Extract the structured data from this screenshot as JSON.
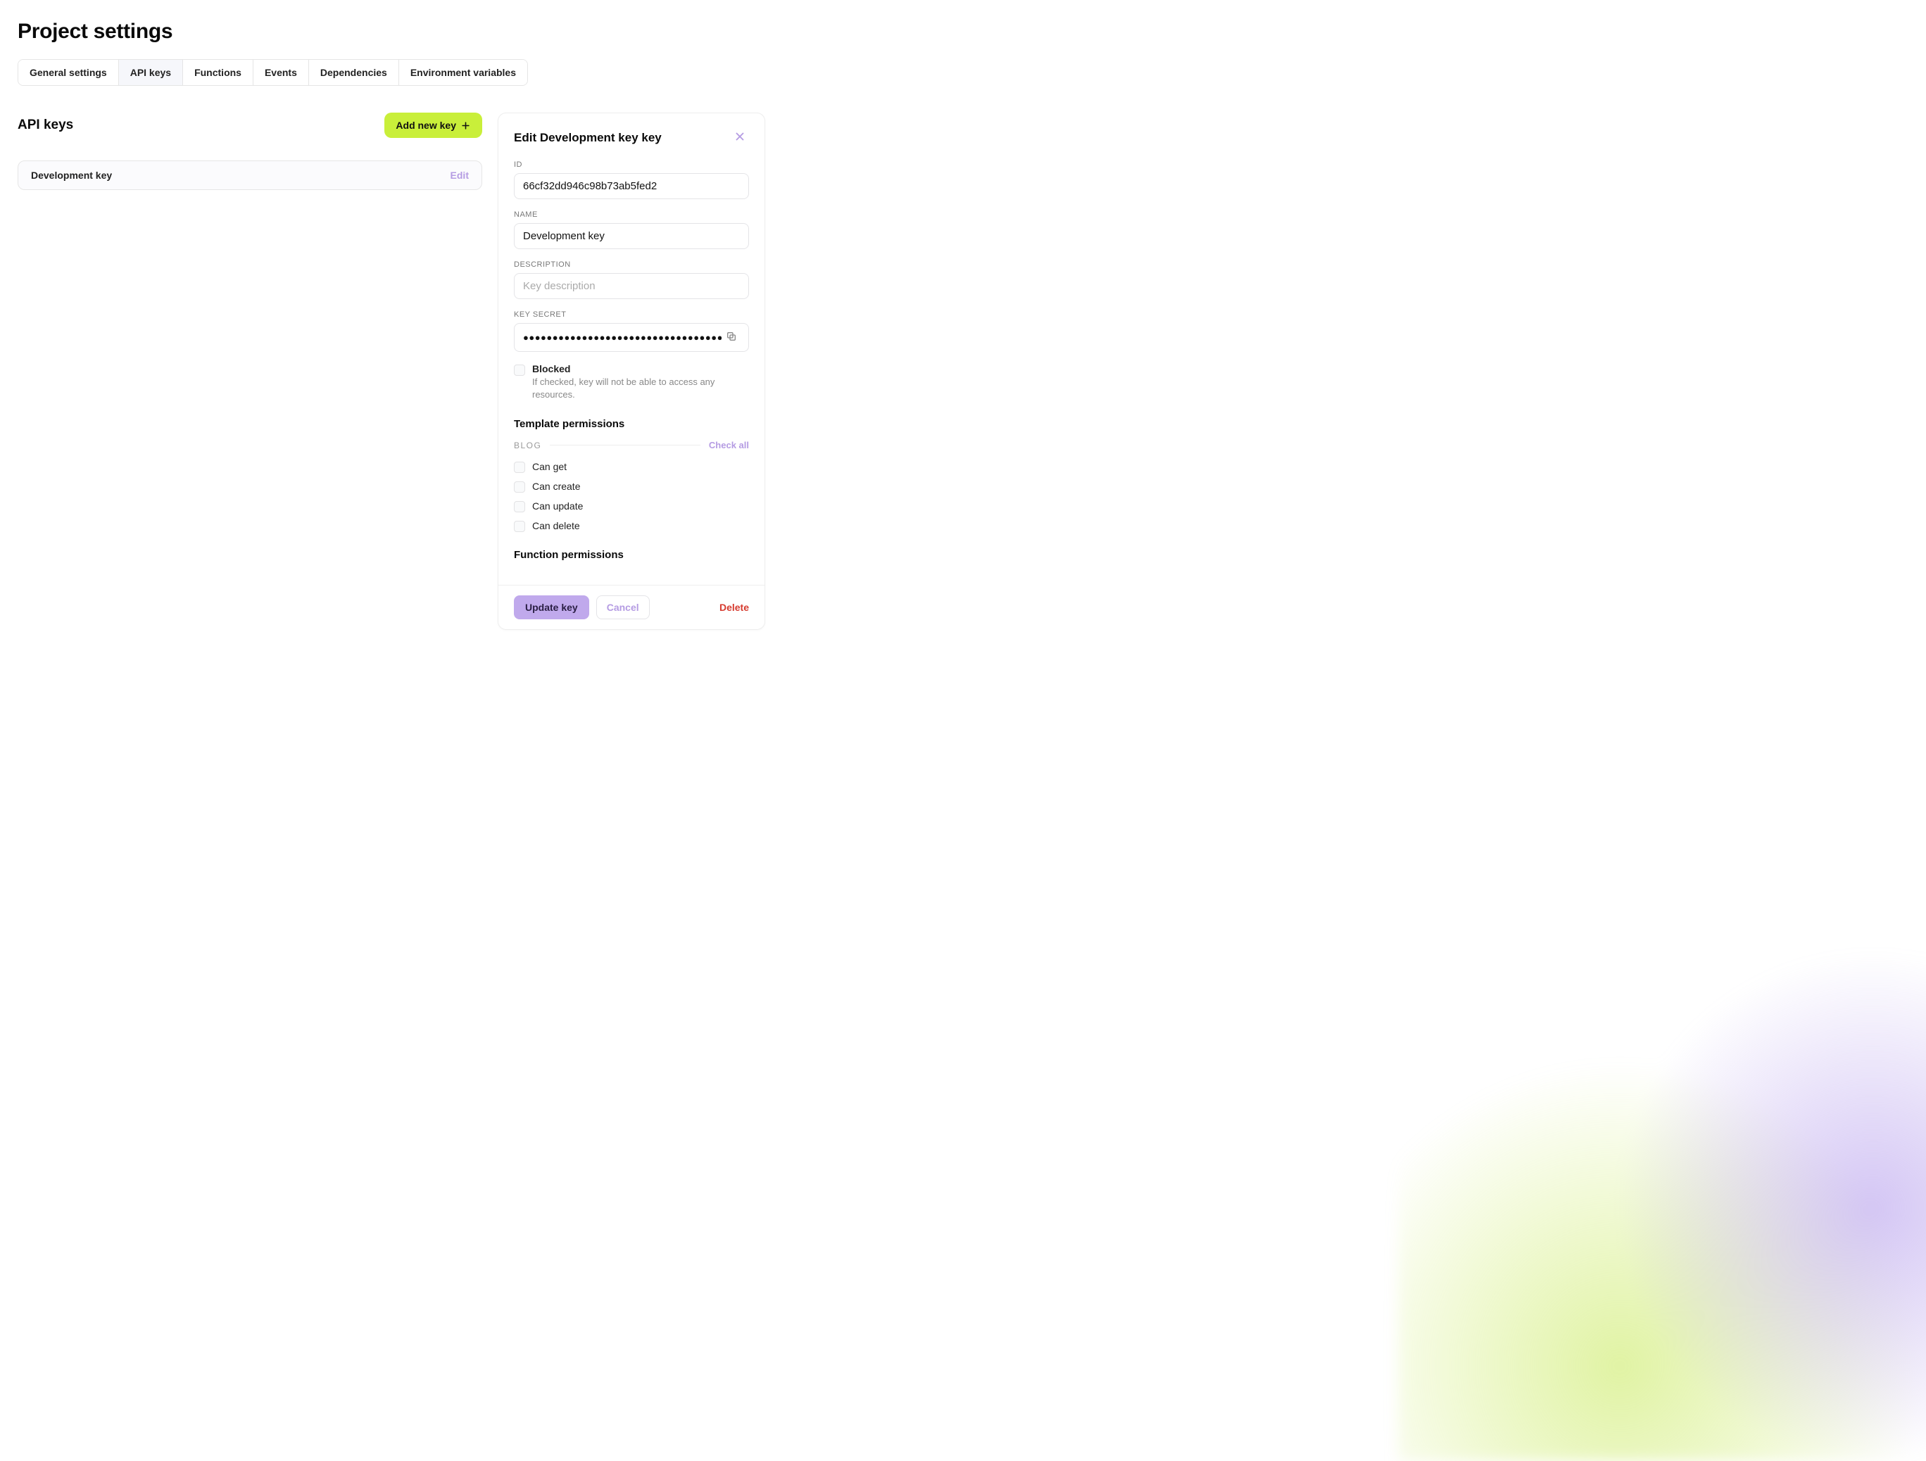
{
  "page": {
    "title": "Project settings"
  },
  "tabs": [
    {
      "label": "General settings",
      "active": false
    },
    {
      "label": "API keys",
      "active": true
    },
    {
      "label": "Functions",
      "active": false
    },
    {
      "label": "Events",
      "active": false
    },
    {
      "label": "Dependencies",
      "active": false
    },
    {
      "label": "Environment variables",
      "active": false
    }
  ],
  "section": {
    "title": "API keys",
    "add_button": "Add new key"
  },
  "keys": [
    {
      "name": "Development key",
      "edit_label": "Edit"
    }
  ],
  "panel": {
    "title": "Edit Development key key",
    "fields": {
      "id_label": "ID",
      "id_value": "66cf32dd946c98b73ab5fed2",
      "name_label": "NAME",
      "name_value": "Development key",
      "description_label": "DESCRIPTION",
      "description_placeholder": "Key description",
      "secret_label": "KEY SECRET",
      "secret_masked": "●●●●●●●●●●●●●●●●●●●●●●●●●●●●●●●●●●●●●●●●●●●●●●●",
      "blocked_label": "Blocked",
      "blocked_desc": "If checked, key will not be able to access any resources."
    },
    "template_permissions": {
      "title": "Template permissions",
      "group": "BLOG",
      "check_all": "Check all",
      "perms": [
        "Can get",
        "Can create",
        "Can update",
        "Can delete"
      ]
    },
    "function_permissions": {
      "title": "Function permissions"
    },
    "footer": {
      "update": "Update key",
      "cancel": "Cancel",
      "delete": "Delete"
    }
  }
}
